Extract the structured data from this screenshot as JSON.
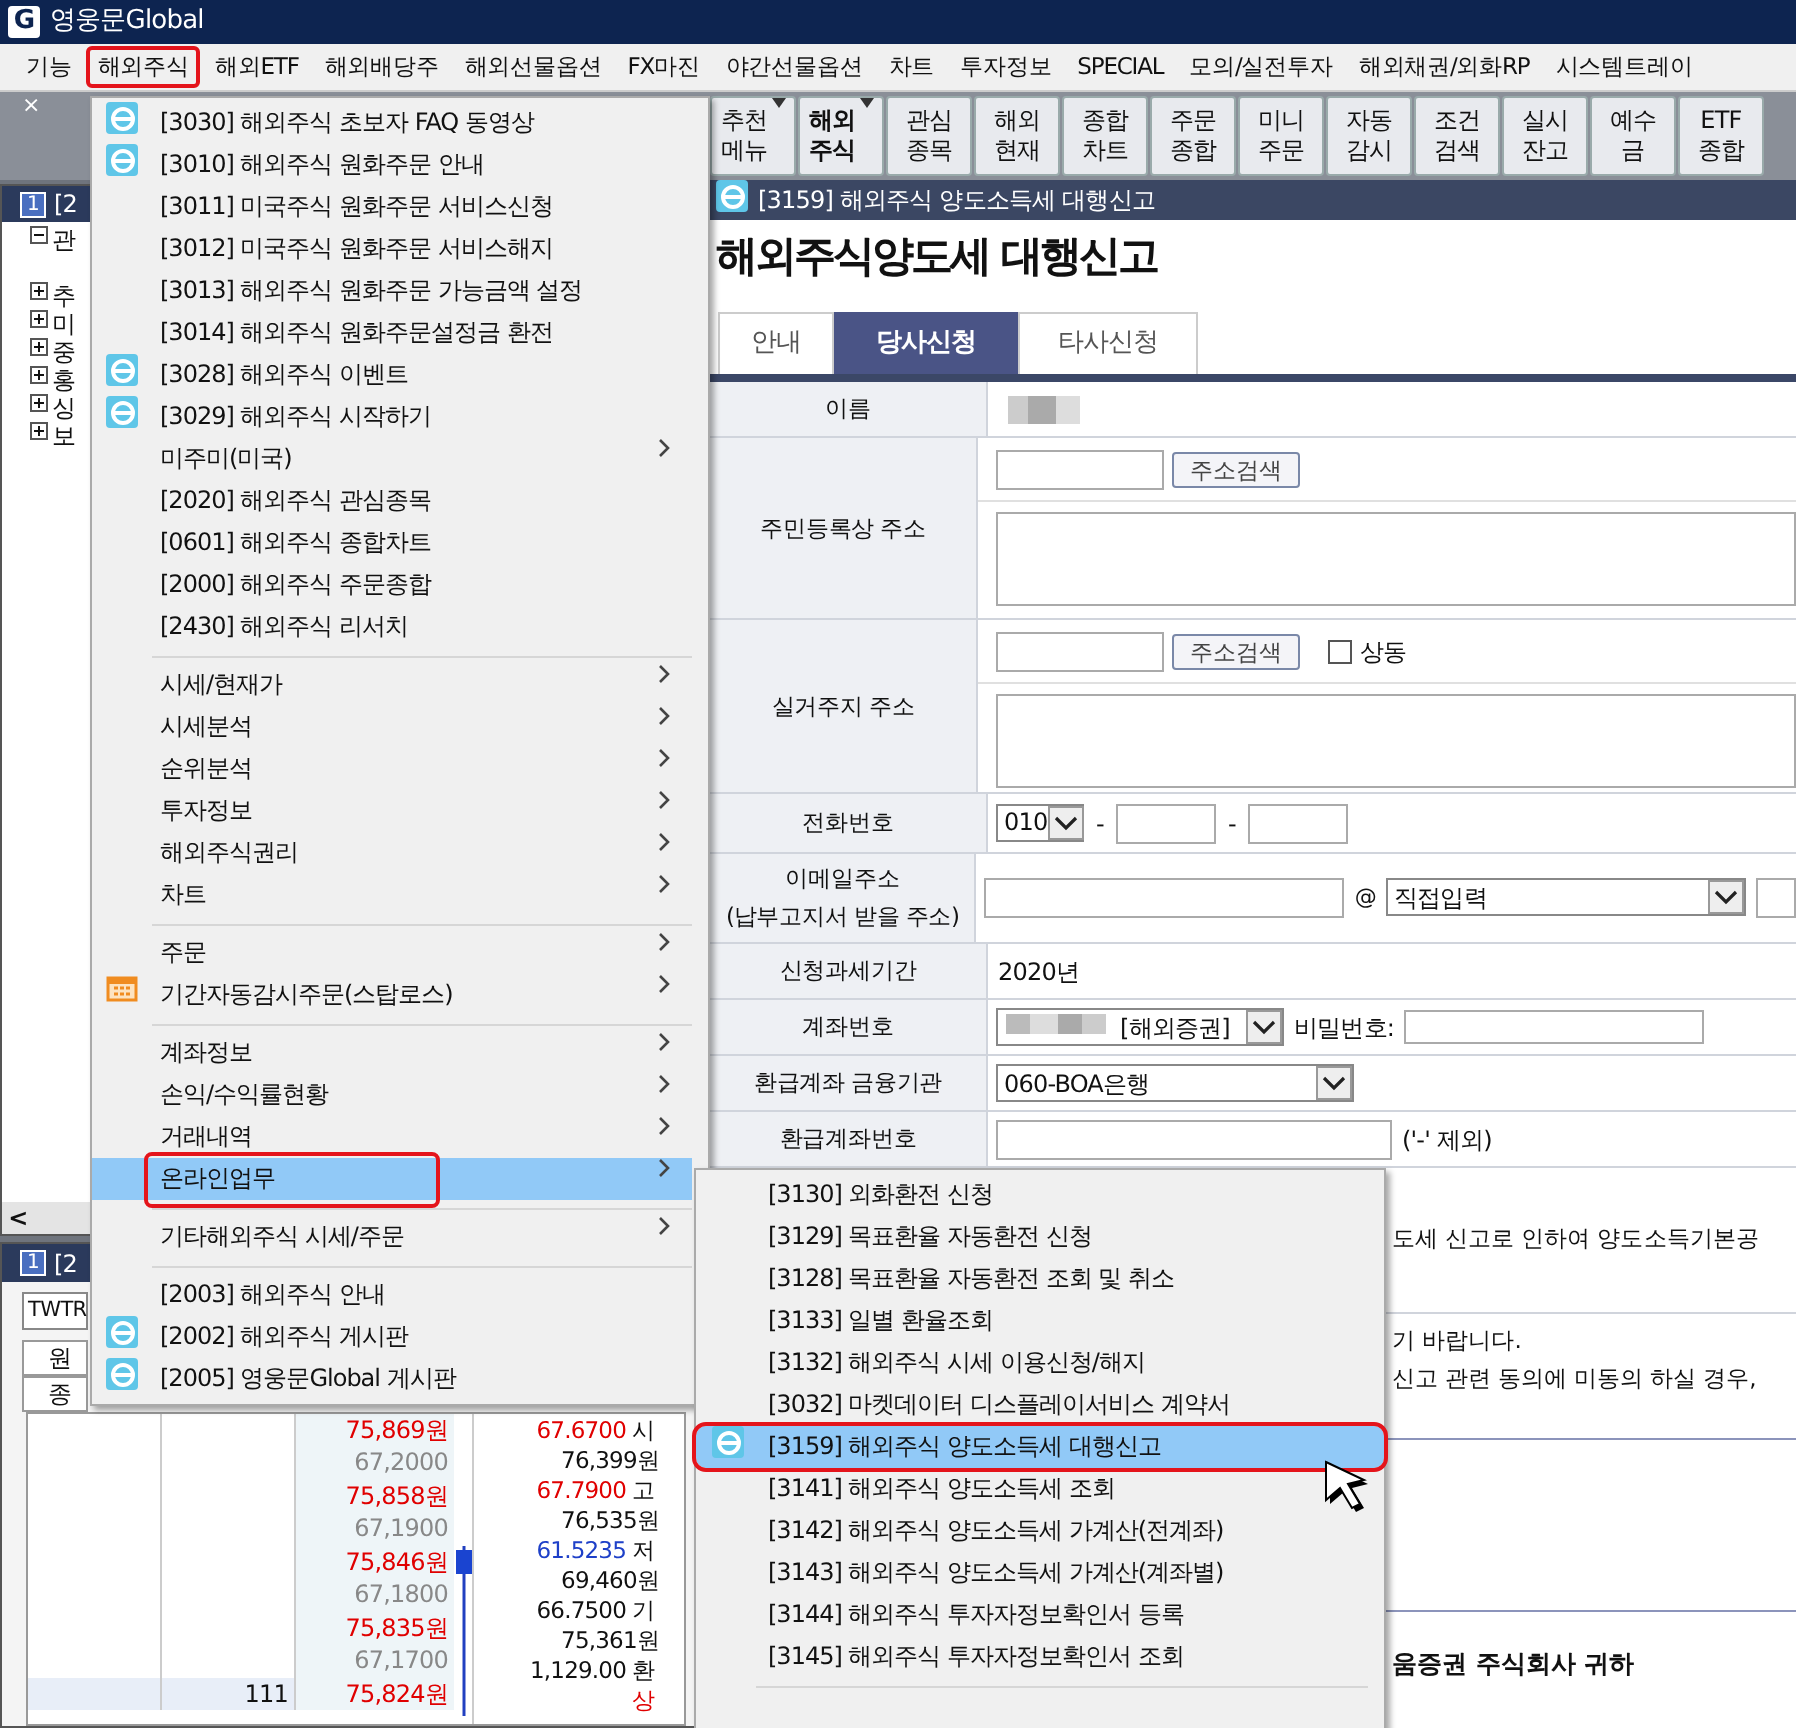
{
  "app": {
    "logo_letter": "G",
    "title": "영웅문Global"
  },
  "menubar": [
    {
      "label": "기능",
      "annotated": false
    },
    {
      "label": "해외주식",
      "annotated": true
    },
    {
      "label": "해외ETF",
      "annotated": false
    },
    {
      "label": "해외배당주",
      "annotated": false
    },
    {
      "label": "해외선물옵션",
      "annotated": false
    },
    {
      "label": "FX마진",
      "annotated": false
    },
    {
      "label": "야간선물옵션",
      "annotated": false
    },
    {
      "label": "차트",
      "annotated": false
    },
    {
      "label": "투자정보",
      "annotated": false
    },
    {
      "label": "SPECIAL",
      "annotated": false
    },
    {
      "label": "모의/실전투자",
      "annotated": false
    },
    {
      "label": "해외채권/외화RP",
      "annotated": false
    },
    {
      "label": "시스템트레이",
      "annotated": false
    }
  ],
  "toolbar": {
    "close_glyph": "×",
    "buttons": [
      {
        "lines": [
          "추천",
          "메뉴"
        ],
        "dropdown": true,
        "bold": false
      },
      {
        "lines": [
          "해외",
          "주식"
        ],
        "dropdown": true,
        "bold": true
      },
      {
        "lines": [
          "관심",
          "종목"
        ],
        "dropdown": false,
        "bold": false
      },
      {
        "lines": [
          "해외",
          "현재"
        ],
        "dropdown": false,
        "bold": false
      },
      {
        "lines": [
          "종합",
          "차트"
        ],
        "dropdown": false,
        "bold": false
      },
      {
        "lines": [
          "주문",
          "종합"
        ],
        "dropdown": false,
        "bold": false
      },
      {
        "lines": [
          "미니",
          "주문"
        ],
        "dropdown": false,
        "bold": false
      },
      {
        "lines": [
          "자동",
          "감시"
        ],
        "dropdown": false,
        "bold": false
      },
      {
        "lines": [
          "조건",
          "검색"
        ],
        "dropdown": false,
        "bold": false
      },
      {
        "lines": [
          "실시",
          "잔고"
        ],
        "dropdown": false,
        "bold": false
      },
      {
        "lines": [
          "예수",
          "금"
        ],
        "dropdown": false,
        "bold": false
      },
      {
        "lines": [
          "ETF",
          "종합"
        ],
        "dropdown": false,
        "bold": false
      }
    ]
  },
  "left_panel": {
    "badge": "1",
    "title": "[2",
    "scroll_glyph": "<",
    "tree": [
      {
        "label": "관",
        "expanded": true
      },
      {
        "label": "추",
        "expanded": false
      },
      {
        "label": "미",
        "expanded": false
      },
      {
        "label": "중",
        "expanded": false
      },
      {
        "label": "홍",
        "expanded": false
      },
      {
        "label": "싱",
        "expanded": false
      },
      {
        "label": "보",
        "expanded": false
      }
    ]
  },
  "lower_panel": {
    "badge": "1",
    "title": "[2",
    "symbol": "TWTR",
    "headers": [
      "원",
      "종"
    ],
    "price_rows": [
      {
        "price": "75,869원",
        "sub": "67,2000"
      },
      {
        "price": "75,858원",
        "sub": "67,1900"
      },
      {
        "price": "75,846원",
        "sub": "67,1800"
      },
      {
        "price": "75,835원",
        "sub": "67,1700"
      },
      {
        "price": "75,824원",
        "volume": "111"
      }
    ],
    "summary_rows": [
      {
        "value": "67.6700",
        "label": "시",
        "color": "#e00000"
      },
      {
        "value": "76,399원"
      },
      {
        "value": "67.7900",
        "label": "고",
        "color": "#e00000"
      },
      {
        "value": "76,535원"
      },
      {
        "value": "61.5235",
        "label": "저",
        "color": "#1e40c8"
      },
      {
        "value": "69,460원"
      },
      {
        "value": "66.7500",
        "label": "기"
      },
      {
        "value": "75,361원"
      },
      {
        "value": "1,129.00",
        "label": "환"
      }
    ],
    "trailing_mark": {
      "text": "상",
      "color": "#e00000"
    }
  },
  "window": {
    "title": "[3159] 해외주식 양도소득세 대행신고",
    "heading": "해외주식양도세 대행신고",
    "tabs": [
      {
        "label": "안내",
        "selected": false
      },
      {
        "label": "당사신청",
        "selected": true
      },
      {
        "label": "타사신청",
        "selected": false
      }
    ],
    "form": {
      "name": {
        "label": "이름",
        "redacted": true
      },
      "registered_address": {
        "label": "주민등록상 주소",
        "search_button": "주소검색"
      },
      "residence_address": {
        "label": "실거주지 주소",
        "search_button": "주소검색",
        "same_checkbox": {
          "label": "상동",
          "checked": false
        }
      },
      "phone": {
        "label": "전화번호",
        "prefix": "010",
        "separators": [
          "-",
          "-"
        ]
      },
      "email": {
        "label_lines": [
          "이메일주소",
          "(납부고지서 받을 주소)"
        ],
        "at": "@",
        "domain": "직접입력"
      },
      "tax_period": {
        "label": "신청과세기간",
        "value": "2020년"
      },
      "account": {
        "label": "계좌번호",
        "redacted": true,
        "account_type": "[해외증권]",
        "password_label": "비밀번호:"
      },
      "refund_bank": {
        "label": "환급계좌 금융기관",
        "value": "060-BOA은행"
      },
      "refund_account": {
        "label": "환급계좌번호",
        "hint": "('-' 제외)"
      }
    },
    "notices": [
      "도세 신고로 인하여 양도소득기본공",
      "기 바랍니다.",
      "신고 관련 동의에 미동의 하실 경우,"
    ],
    "closing": "움증권 주식회사 귀하"
  },
  "dropdown_menu": {
    "items": [
      {
        "kind": "weblink",
        "label": "[3030] 해외주식 초보자 FAQ 동영상",
        "selected": false,
        "annotated": false
      },
      {
        "kind": "weblink",
        "label": "[3010] 해외주식 원화주문 안내",
        "selected": false,
        "annotated": false
      },
      {
        "kind": "command",
        "label": "[3011] 미국주식 원화주문 서비스신청",
        "selected": false,
        "annotated": false
      },
      {
        "kind": "command",
        "label": "[3012] 미국주식 원화주문 서비스해지",
        "selected": false,
        "annotated": false
      },
      {
        "kind": "command",
        "label": "[3013] 해외주식 원화주문 가능금액 설정",
        "selected": false,
        "annotated": false
      },
      {
        "kind": "command",
        "label": "[3014] 해외주식 원화주문설정금 환전",
        "selected": false,
        "annotated": false
      },
      {
        "kind": "weblink",
        "label": "[3028] 해외주식 이벤트",
        "selected": false,
        "annotated": false
      },
      {
        "kind": "weblink",
        "label": "[3029] 해외주식 시작하기",
        "selected": false,
        "annotated": false
      },
      {
        "kind": "submenu",
        "label": "미주미(미국)",
        "selected": false,
        "annotated": false
      },
      {
        "kind": "command",
        "label": "[2020] 해외주식 관심종목",
        "selected": false,
        "annotated": false
      },
      {
        "kind": "command",
        "label": "[0601] 해외주식 종합차트",
        "selected": false,
        "annotated": false
      },
      {
        "kind": "command",
        "label": "[2000] 해외주식 주문종합",
        "selected": false,
        "annotated": false
      },
      {
        "kind": "command",
        "label": "[2430] 해외주식 리서치",
        "selected": false,
        "annotated": false
      },
      {
        "kind": "separator"
      },
      {
        "kind": "submenu",
        "label": "시세/현재가",
        "selected": false,
        "annotated": false
      },
      {
        "kind": "submenu",
        "label": "시세분석",
        "selected": false,
        "annotated": false
      },
      {
        "kind": "submenu",
        "label": "순위분석",
        "selected": false,
        "annotated": false
      },
      {
        "kind": "submenu",
        "label": "투자정보",
        "selected": false,
        "annotated": false
      },
      {
        "kind": "submenu",
        "label": "해외주식권리",
        "selected": false,
        "annotated": false
      },
      {
        "kind": "submenu",
        "label": "차트",
        "selected": false,
        "annotated": false
      },
      {
        "kind": "separator"
      },
      {
        "kind": "submenu",
        "label": "주문",
        "selected": false,
        "annotated": false
      },
      {
        "kind": "schedule",
        "label": "기간자동감시주문(스탑로스)",
        "selected": false,
        "annotated": false
      },
      {
        "kind": "separator"
      },
      {
        "kind": "submenu",
        "label": "계좌정보",
        "selected": false,
        "annotated": false
      },
      {
        "kind": "submenu",
        "label": "손익/수익률현황",
        "selected": false,
        "annotated": false
      },
      {
        "kind": "submenu",
        "label": "거래내역",
        "selected": false,
        "annotated": false
      },
      {
        "kind": "submenu",
        "label": "온라인업무",
        "selected": true,
        "annotated": true
      },
      {
        "kind": "separator"
      },
      {
        "kind": "submenu",
        "label": "기타해외주식 시세/주문",
        "selected": false,
        "annotated": false
      },
      {
        "kind": "separator"
      },
      {
        "kind": "command",
        "label": "[2003] 해외주식 안내",
        "selected": false,
        "annotated": false
      },
      {
        "kind": "weblink",
        "label": "[2002] 해외주식 게시판",
        "selected": false,
        "annotated": false
      },
      {
        "kind": "weblink",
        "label": "[2005] 영웅문Global 게시판",
        "selected": false,
        "annotated": false
      }
    ]
  },
  "submenu": {
    "items": [
      {
        "kind": "command",
        "label": "[3130] 외화환전 신청",
        "selected": false,
        "annotated": false
      },
      {
        "kind": "command",
        "label": "[3129] 목표환율 자동환전 신청",
        "selected": false,
        "annotated": false
      },
      {
        "kind": "command",
        "label": "[3128] 목표환율 자동환전 조회 및 취소",
        "selected": false,
        "annotated": false
      },
      {
        "kind": "command",
        "label": "[3133] 일별 환율조회",
        "selected": false,
        "annotated": false
      },
      {
        "kind": "command",
        "label": "[3132] 해외주식 시세 이용신청/해지",
        "selected": false,
        "annotated": false
      },
      {
        "kind": "command",
        "label": "[3032] 마켓데이터 디스플레이서비스 계약서",
        "selected": false,
        "annotated": false
      },
      {
        "kind": "weblink",
        "label": "[3159] 해외주식 양도소득세 대행신고",
        "selected": true,
        "annotated": true
      },
      {
        "kind": "command",
        "label": "[3141] 해외주식 양도소득세 조회",
        "selected": false,
        "annotated": false
      },
      {
        "kind": "command",
        "label": "[3142] 해외주식 양도소득세 가계산(전계좌)",
        "selected": false,
        "annotated": false
      },
      {
        "kind": "command",
        "label": "[3143] 해외주식 양도소득세 가계산(계좌별)",
        "selected": false,
        "annotated": false
      },
      {
        "kind": "command",
        "label": "[3144] 해외주식 투자자정보확인서 등록",
        "selected": false,
        "annotated": false
      },
      {
        "kind": "command",
        "label": "[3145] 해외주식 투자자정보확인서 조회",
        "selected": false,
        "annotated": false
      },
      {
        "kind": "separator"
      }
    ]
  }
}
